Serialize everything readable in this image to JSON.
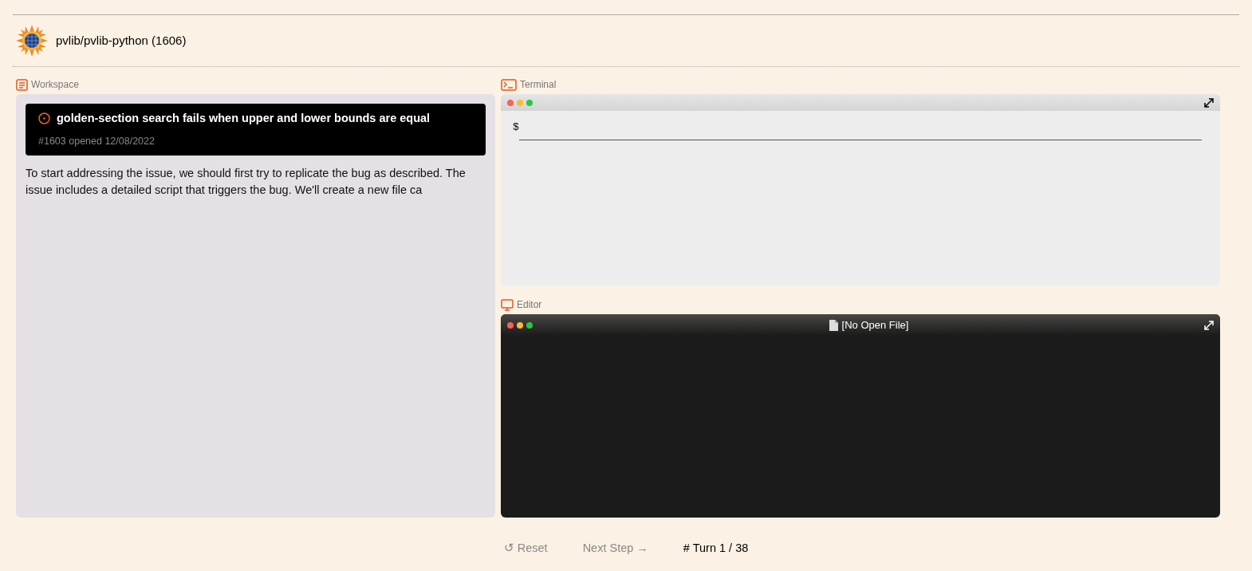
{
  "header": {
    "title": "pvlib/pvlib-python (1606)"
  },
  "workspace": {
    "label": "Workspace",
    "issue": {
      "title": "golden-section search fails when upper and lower bounds are equal",
      "meta": "#1603 opened 12/08/2022"
    },
    "message": "To start addressing the issue, we should first try to replicate the bug as described. The issue includes a detailed script that triggers the bug. We'll create a new file ca"
  },
  "terminal": {
    "label": "Terminal",
    "prompt": "$"
  },
  "editor": {
    "label": "Editor",
    "file_title": "[No Open File]"
  },
  "controls": [
    {
      "kind": "button",
      "icon": "↺",
      "label": "Reset",
      "disabled": true
    },
    {
      "kind": "button",
      "label": "Next Step",
      "icon": "→",
      "disabled": true
    },
    {
      "kind": "counter",
      "icon": "#",
      "label": "Turn 1 / 38"
    }
  ]
}
